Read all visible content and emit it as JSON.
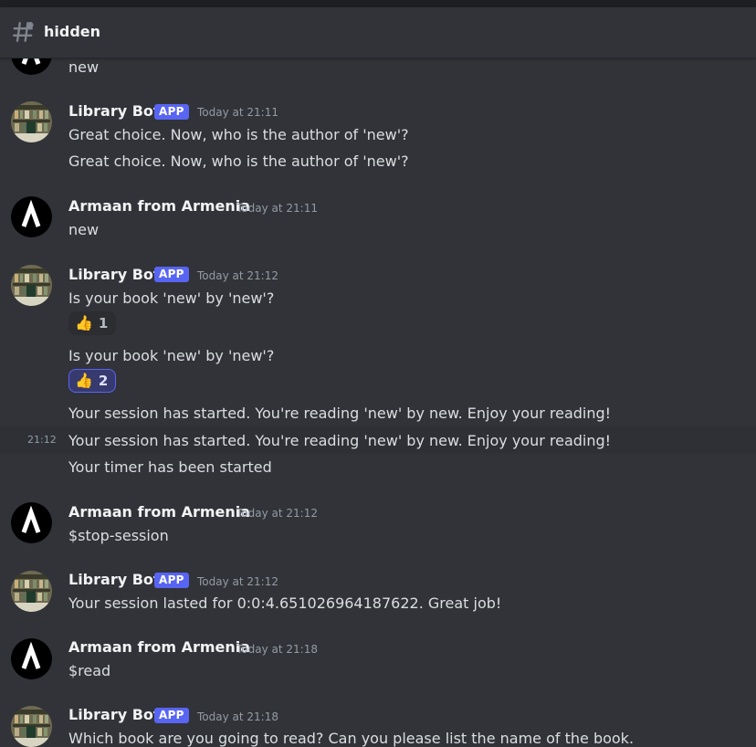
{
  "channel": {
    "name": "hidden",
    "icon": "hash-icon"
  },
  "users": {
    "bot": {
      "name": "Library Bot",
      "tag": "APP",
      "avatar": "library-bot-avatar"
    },
    "armaan": {
      "name": "Armaan from Armenia",
      "avatar": "armaan-avatar"
    }
  },
  "messages": {
    "m0": {
      "text": "new"
    },
    "m1": {
      "author": "Library Bot",
      "tag": "APP",
      "timestamp": "Today at 21:11",
      "line1": "Great choice. Now, who is the author of 'new'?",
      "line2": "Great choice. Now, who is the author of 'new'?"
    },
    "m2": {
      "author": "Armaan from Armenia",
      "timestamp": "Today at 21:11",
      "text": "new"
    },
    "m3": {
      "author": "Library Bot",
      "tag": "APP",
      "timestamp": "Today at 21:12",
      "line1": "Is your book 'new' by 'new'?",
      "reaction1": {
        "emoji": "👍",
        "count": "1"
      },
      "line2": "Is your book 'new' by 'new'?",
      "reaction2": {
        "emoji": "👍",
        "count": "2"
      },
      "line3": "Your session has started. You're reading 'new' by new. Enjoy your reading!",
      "line4_time": "21:12",
      "line4": "Your session has started. You're reading 'new' by new. Enjoy your reading!",
      "line5": "Your timer has been started"
    },
    "m4": {
      "author": "Armaan from Armenia",
      "timestamp": "Today at 21:12",
      "text": "$stop-session"
    },
    "m5": {
      "author": "Library Bot",
      "tag": "APP",
      "timestamp": "Today at 21:12",
      "text": "Your session lasted for 0:0:4.651026964187622. Great job!"
    },
    "m6": {
      "author": "Armaan from Armenia",
      "timestamp": "Today at 21:18",
      "text": "$read"
    },
    "m7": {
      "author": "Library Bot",
      "tag": "APP",
      "timestamp": "Today at 21:18",
      "text": "Which book are you going to read? Can you please list the name of the book."
    }
  },
  "colors": {
    "background": "#313338",
    "accent": "#5865f2",
    "text": "#dbdee1",
    "muted": "#949ba4"
  }
}
